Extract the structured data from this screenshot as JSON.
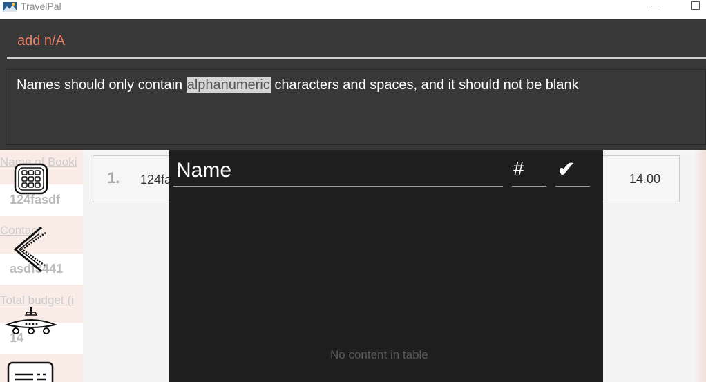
{
  "window": {
    "title": "TravelPal",
    "minimize_glyph": "—"
  },
  "command_box": {
    "value": "add n/A"
  },
  "result_display": {
    "text_before": "Names should only contain ",
    "text_highlight": "alphanumeric",
    "text_after": " characters and spaces, and it should not be blank"
  },
  "details": {
    "name_label": "Name of Booki",
    "name_value": "124fasdf",
    "contact_label": "Contact:",
    "contact_value": "asdf3441",
    "budget_label": "Total budget (i",
    "budget_value": "14"
  },
  "booking": {
    "index": "1.",
    "name": "124fa",
    "amount": "14.00"
  },
  "table": {
    "columns": [
      "Name",
      "#",
      "✔"
    ],
    "empty_message": "No content in table"
  },
  "sidebar": {
    "icons": [
      "calculator-icon",
      "back-arrow-icon",
      "airplane-icon",
      "document-icon"
    ]
  }
}
